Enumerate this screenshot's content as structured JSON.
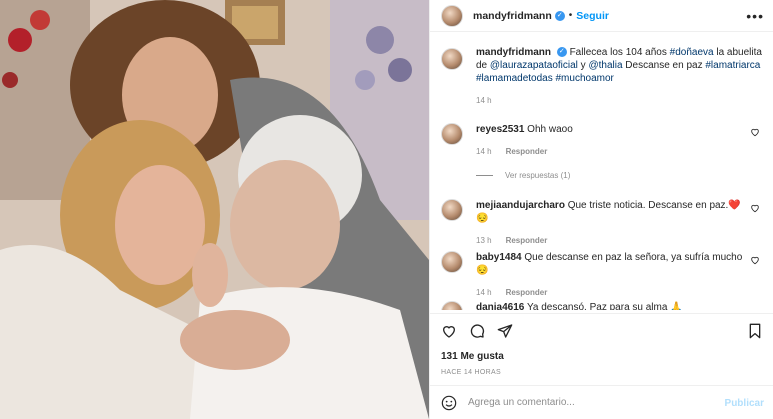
{
  "post": {
    "username": "mandyfridmann",
    "follow_label": "Seguir",
    "dot": "•",
    "more_label": "•••"
  },
  "caption": {
    "username": "mandyfridmann",
    "text_1": " Fallecea los 104 años ",
    "tag_1": "#doñaeva",
    "text_2": " la abuelita de ",
    "tag_2": "@laurazapataoficial",
    "text_3": " y ",
    "tag_3": "@thalia",
    "text_4": " Descanse en paz ",
    "tag_4": "#lamatriarca",
    "tag_5": "#lamamadetodas",
    "tag_6": "#muchoamor",
    "time": "14 h"
  },
  "comments": [
    {
      "username": "reyes2531",
      "text": " Ohh waoo",
      "time": "14 h",
      "reply": "Responder"
    },
    {
      "username": "mejiaandujarcharo",
      "text": " Que triste noticia. Descanse en paz.",
      "emoji": "❤️😔",
      "time": "13 h",
      "reply": "Responder"
    },
    {
      "username": "baby1484",
      "text": " Que descanse en paz la señora, ya sufría mucho",
      "emoji": "😔",
      "time": "14 h",
      "reply": "Responder"
    },
    {
      "username": "dania4616",
      "text": " Ya descansó. Paz para su alma",
      "emoji": "🙏"
    }
  ],
  "view_replies": "Ver respuestas (1)",
  "likes": "131 Me gusta",
  "posted_time": "HACE 14 HORAS",
  "add_comment": {
    "placeholder": "Agrega un comentario...",
    "publish": "Publicar"
  },
  "colors": {
    "follow": "#0095f6",
    "verified": "#3897f0",
    "tag": "#00376b",
    "muted": "#8e8e8e",
    "publish_disabled": "#b2dffc"
  },
  "icons": [
    "heart-icon",
    "comment-icon",
    "share-icon",
    "bookmark-icon",
    "emoji-icon",
    "verified-icon",
    "more-icon"
  ]
}
